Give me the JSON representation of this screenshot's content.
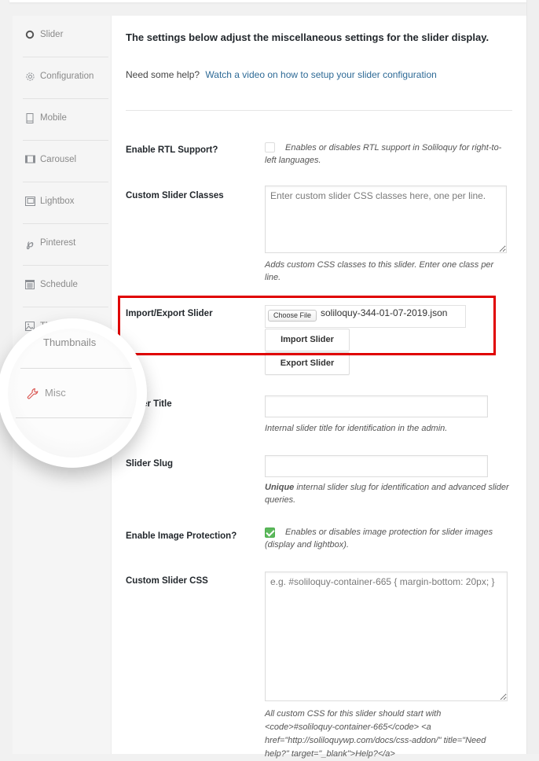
{
  "sidebar": {
    "items": [
      {
        "label": "Slider",
        "icon": "circle-ring-icon"
      },
      {
        "label": "Configuration",
        "icon": "gear-icon"
      },
      {
        "label": "Mobile",
        "icon": "mobile-icon"
      },
      {
        "label": "Carousel",
        "icon": "carousel-icon"
      },
      {
        "label": "Lightbox",
        "icon": "lightbox-icon"
      },
      {
        "label": "Pinterest",
        "icon": "pinterest-icon"
      },
      {
        "label": "Schedule",
        "icon": "calendar-icon"
      },
      {
        "label": "Thumbnails",
        "icon": "image-icon"
      },
      {
        "label": "Misc",
        "icon": "wrench-icon",
        "active": true
      }
    ],
    "magnified_label": "Misc",
    "magnified_partial": "Thumbnails"
  },
  "main": {
    "intro": "The settings below adjust the miscellaneous settings for the slider display.",
    "help_prefix": "Need some help?",
    "help_link": "Watch a video on how to setup your slider configuration",
    "fields": {
      "rtl": {
        "label": "Enable RTL Support?",
        "checked": false,
        "description": "Enables or disables RTL support in Soliloquy for right-to-left languages."
      },
      "classes": {
        "label": "Custom Slider Classes",
        "placeholder": "Enter custom slider CSS classes here, one per line.",
        "value": "",
        "description": "Adds custom CSS classes to this slider. Enter one class per line."
      },
      "import_export": {
        "label": "Import/Export Slider",
        "choose_file": "Choose File",
        "file_name": "soliloquy-344-01-07-2019.json",
        "import_button": "Import Slider",
        "export_button": "Export Slider"
      },
      "title": {
        "label": "Slider Title",
        "value": "",
        "description": "Internal slider title for identification in the admin."
      },
      "slug": {
        "label": "Slider Slug",
        "value": "",
        "description_strong": "Unique",
        "description": " internal slider slug for identification and advanced slider queries."
      },
      "protection": {
        "label": "Enable Image Protection?",
        "checked": true,
        "description": "Enables or disables image protection for slider images (display and lightbox)."
      },
      "css": {
        "label": "Custom Slider CSS",
        "placeholder": "e.g. #soliloquy-container-665 { margin-bottom: 20px; }",
        "value": "",
        "description": "All custom CSS for this slider should start with <code>#soliloquy-container-665</code> <a href=\"http://soliloquywp.com/docs/css-addon/\" title=\"Need help?\" target=\"_blank\">Help?</a>"
      }
    }
  },
  "colors": {
    "highlight": "#e00000",
    "link": "#2e6a96",
    "active_icon": "#d9534f",
    "checkbox_checked": "#5cb85c"
  }
}
